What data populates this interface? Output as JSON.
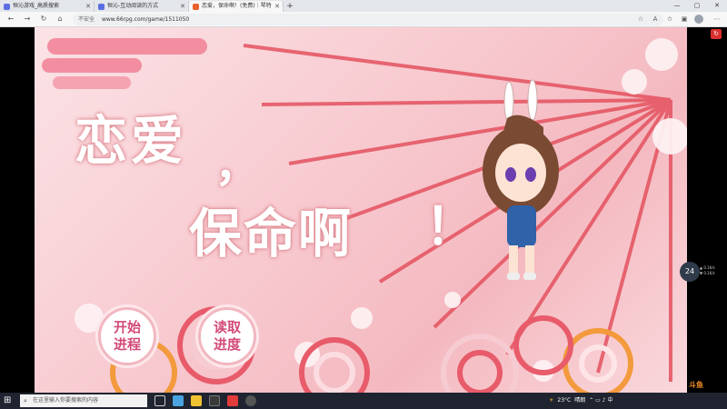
{
  "browser": {
    "tabs": [
      {
        "title": "恒沁游戏_高质搜索",
        "active": false
      },
      {
        "title": "恒沁-互动阅读的方式",
        "active": false
      },
      {
        "title": "恋爱，保命啊！(免费)｜琴特",
        "active": true
      }
    ],
    "new_tab": "+",
    "window_controls": [
      "—",
      "▢",
      "✕"
    ],
    "security_label": "不安全",
    "url": "www.66rpg.com/game/1511050"
  },
  "game": {
    "title_line1": "恋爱",
    "title_comma": "，",
    "title_line2": "保命啊",
    "title_exclaim": "！",
    "start_button": "开始进程",
    "load_button": "读取进度"
  },
  "overlay": {
    "side_widget_value": "24",
    "side_widget_label_1": "▲ 0.1K/s",
    "side_widget_label_2": "▼ 0.1K/s",
    "red_tag": "↻",
    "watermark": "斗鱼"
  },
  "taskbar": {
    "start_glyph": "⊞",
    "search_placeholder": "在这里输入你要搜索的内容",
    "weather": "23°C",
    "weather_desc": "晴朗",
    "tray_icons": "⌃ ▭ ♪ 中"
  },
  "colors": {
    "accent_pink": "#d24b7a",
    "background_pink": "#f7c9cf",
    "umbrella_red": "#e4525f"
  }
}
